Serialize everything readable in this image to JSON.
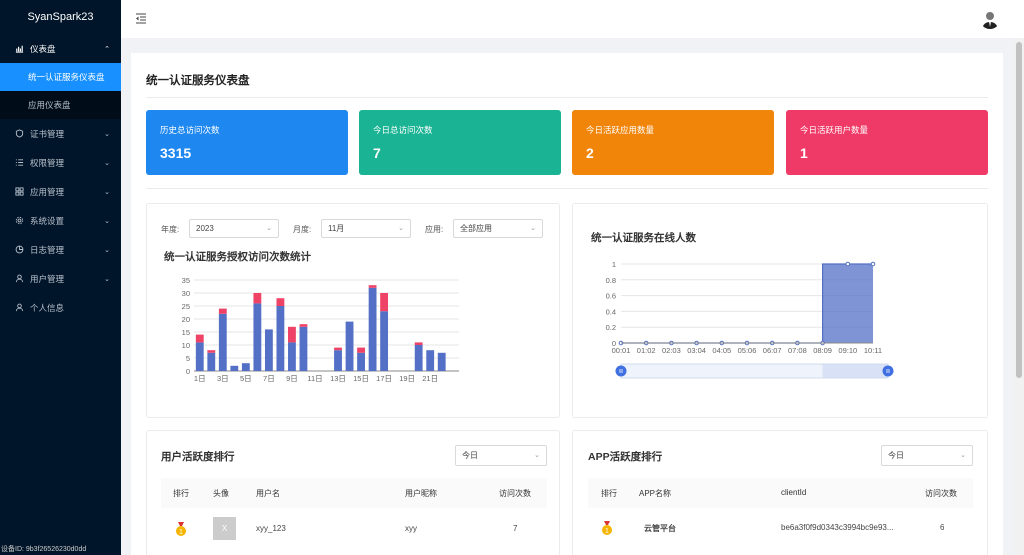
{
  "app": {
    "title": "SyanSpark23",
    "device_id": "设备ID: 9b3f2652623​0d0dd"
  },
  "sidebar": {
    "items": [
      {
        "label": "仪表盘",
        "icon": "dashboard-icon",
        "open": true,
        "children": [
          {
            "label": "统一认证服务仪表盘",
            "active": true
          },
          {
            "label": "应用仪表盘",
            "active": false
          }
        ]
      },
      {
        "label": "证书管理",
        "icon": "shield-icon"
      },
      {
        "label": "权限管理",
        "icon": "list-icon"
      },
      {
        "label": "应用管理",
        "icon": "apps-icon"
      },
      {
        "label": "系统设置",
        "icon": "gear-icon"
      },
      {
        "label": "日志管理",
        "icon": "pie-icon"
      },
      {
        "label": "用户管理",
        "icon": "user-icon"
      },
      {
        "label": "个人信息",
        "icon": "user-icon"
      }
    ]
  },
  "page": {
    "title": "统一认证服务仪表盘"
  },
  "stats": [
    {
      "label": "历史总访问次数",
      "value": "3315",
      "color": "#1e88f0"
    },
    {
      "label": "今日总访问次数",
      "value": "7",
      "color": "#1ab394"
    },
    {
      "label": "今日活跃应用数量",
      "value": "2",
      "color": "#f0850a"
    },
    {
      "label": "今日活跃用户数量",
      "value": "1",
      "color": "#ef3a67"
    }
  ],
  "filters": {
    "year_label": "年度:",
    "year_value": "2023",
    "month_label": "月度:",
    "month_value": "11月",
    "app_label": "应用:",
    "app_value": "全部应用"
  },
  "chart_data": [
    {
      "type": "bar",
      "title": "统一认证服务授权访问次数统计",
      "categories": [
        "1日",
        "2日",
        "3日",
        "4日",
        "5日",
        "6日",
        "7日",
        "8日",
        "9日",
        "10日",
        "11日",
        "12日",
        "13日",
        "14日",
        "15日",
        "16日",
        "17日",
        "18日",
        "19日",
        "20日",
        "21日",
        "22日",
        "23日"
      ],
      "x_tick_labels": [
        "1日",
        "3日",
        "5日",
        "7日",
        "9日",
        "11日",
        "13日",
        "15日",
        "17日",
        "19日",
        "21日"
      ],
      "series": [
        {
          "values": [
            11,
            7,
            22,
            2,
            3,
            26,
            16,
            25,
            11,
            17,
            0,
            0,
            8,
            19,
            7,
            32,
            23,
            0,
            0,
            10,
            8,
            7,
            0
          ],
          "color": "#5470c6"
        },
        {
          "values": [
            3,
            1,
            2,
            0,
            0,
            4,
            0,
            3,
            6,
            1,
            0,
            0,
            1,
            0,
            2,
            1,
            7,
            0,
            0,
            1,
            0,
            0,
            0
          ],
          "color": "#ee4266"
        }
      ],
      "ylim": [
        0,
        35
      ],
      "yticks": [
        0,
        5,
        10,
        15,
        20,
        25,
        30,
        35
      ],
      "grid": true
    },
    {
      "type": "area",
      "title": "统一认证服务在线人数",
      "x": [
        "00:01",
        "01:02",
        "02:03",
        "03:04",
        "04:05",
        "05:06",
        "06:07",
        "07:08",
        "08:09",
        "09:10",
        "10:11"
      ],
      "values": [
        0,
        0,
        0,
        0,
        0,
        0,
        0,
        0,
        0,
        1,
        1
      ],
      "ylim": [
        0,
        1
      ],
      "yticks": [
        "0",
        "0.2",
        "0.4",
        "0.6",
        "0.8",
        "1"
      ],
      "color": "#5470c6",
      "grid": true,
      "zoom_slider": true
    }
  ],
  "user_rank": {
    "title": "用户活跃度排行",
    "filter": "今日",
    "columns": [
      "排行",
      "头像",
      "用户名",
      "用户昵称",
      "访问次数"
    ],
    "rows": [
      {
        "rank_icon": "medal-icon",
        "avatar": "X",
        "username": "xyy_123",
        "nickname": "xyy",
        "count": "7"
      }
    ]
  },
  "app_rank": {
    "title": "APP活跃度排行",
    "filter": "今日",
    "columns": [
      "排行",
      "APP名称",
      "clientId",
      "访问次数"
    ],
    "rows": [
      {
        "rank_icon": "medal-icon",
        "name": "云管平台",
        "client_id": "be6a3f0f9d0343c3994bc9e93...",
        "count": "6"
      }
    ]
  }
}
